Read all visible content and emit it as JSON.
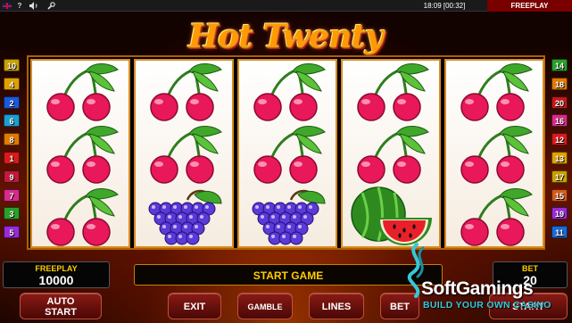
{
  "topbar": {
    "flag_icon": "uk-flag-icon",
    "help": "?",
    "sound_icon": "speaker-icon",
    "settings_icon": "wrench-icon",
    "clock": "18:09 [00:32]",
    "mode": "FREEPLAY"
  },
  "game": {
    "title": "Hot Twenty"
  },
  "reels": [
    [
      "cherry",
      "cherry",
      "cherry"
    ],
    [
      "cherry",
      "cherry",
      "grapes"
    ],
    [
      "cherry",
      "cherry",
      "grapes"
    ],
    [
      "cherry",
      "cherry",
      "watermelon"
    ],
    [
      "cherry",
      "cherry",
      "cherry"
    ]
  ],
  "lines": {
    "left": [
      "10",
      "4",
      "2",
      "6",
      "8",
      "1",
      "9",
      "7",
      "3",
      "5"
    ],
    "right": [
      "14",
      "18",
      "20",
      "16",
      "12",
      "13",
      "17",
      "15",
      "19",
      "11"
    ],
    "colors": {
      "1": "#d81a1a",
      "2": "#1a5ad8",
      "3": "#2aa02a",
      "4": "#e0a000",
      "5": "#9a2ad8",
      "6": "#1aa0d0",
      "7": "#d82a8a",
      "8": "#e07a00",
      "9": "#c01a3a",
      "10": "#c8a000",
      "11": "#1a6ad8",
      "12": "#d81a1a",
      "13": "#e0a000",
      "14": "#2aa02a",
      "15": "#d85a1a",
      "16": "#d82a8a",
      "17": "#c8a000",
      "18": "#e07a00",
      "19": "#9a2ad8",
      "20": "#c01a1a"
    }
  },
  "panel": {
    "freeplay_label": "FREEPLAY",
    "freeplay_value": "10000",
    "message": "START GAME",
    "bet_label": "BET",
    "bet_value": "20"
  },
  "buttons": {
    "auto_start_line1": "AUTO",
    "auto_start_line2": "START",
    "exit": "EXIT",
    "gamble": "GAMBLE",
    "lines": "LINES",
    "bet": "BET",
    "start": "START"
  },
  "watermark": {
    "name": "SoftGamings",
    "tagline": "BUILD YOUR OWN CASINO"
  }
}
